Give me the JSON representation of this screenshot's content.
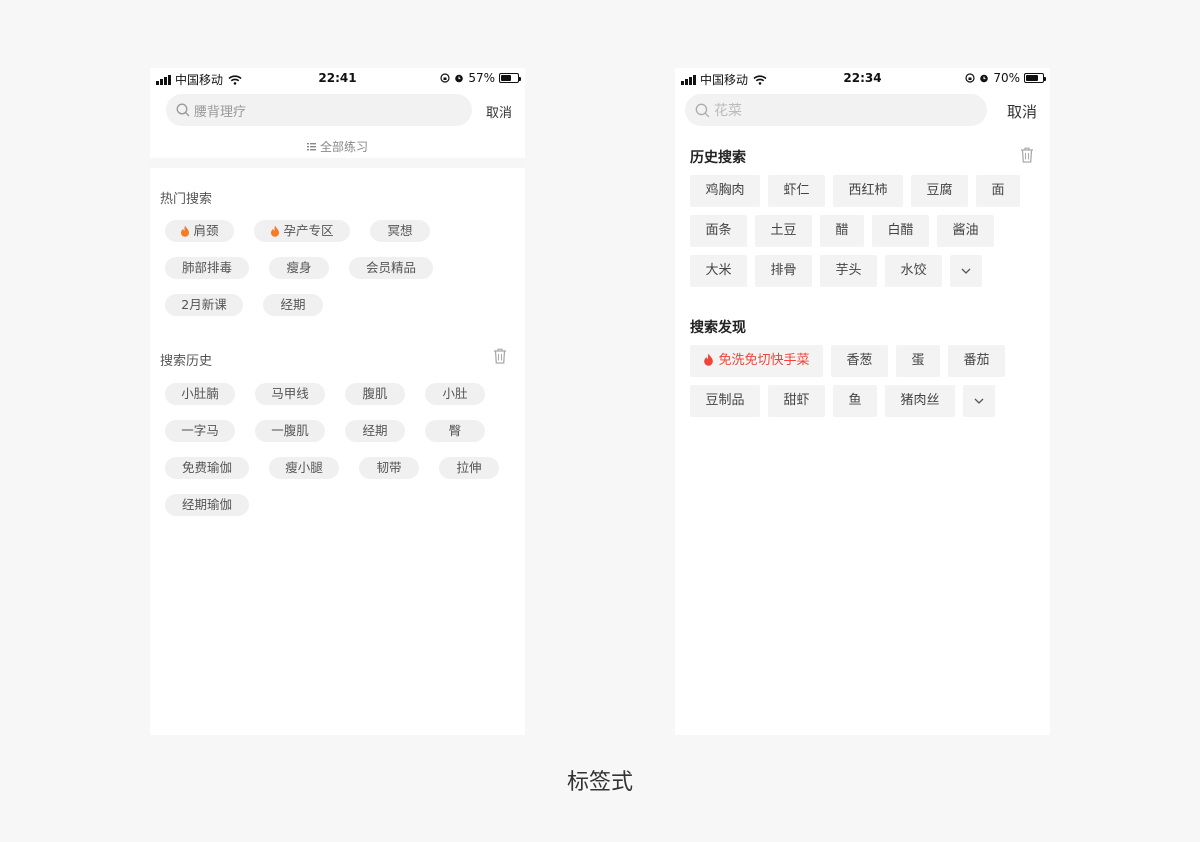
{
  "caption": "标签式",
  "left": {
    "status": {
      "carrier": "中国移动",
      "time": "22:41",
      "battery": "57%",
      "battery_level": 0.57
    },
    "search": {
      "placeholder": "腰背理疗",
      "cancel": "取消"
    },
    "all_practice": "全部练习",
    "hot": {
      "title": "热门搜索",
      "tags": [
        {
          "label": "肩颈",
          "fire": true
        },
        {
          "label": "孕产专区",
          "fire": true
        },
        {
          "label": "冥想",
          "fire": false
        },
        {
          "label": "肺部排毒",
          "fire": false
        },
        {
          "label": "瘦身",
          "fire": false
        },
        {
          "label": "会员精品",
          "fire": false
        },
        {
          "label": "2月新课",
          "fire": false
        },
        {
          "label": "经期",
          "fire": false
        }
      ]
    },
    "history": {
      "title": "搜索历史",
      "tags": [
        "小肚腩",
        "马甲线",
        "腹肌",
        "小肚",
        "一字马",
        "一腹肌",
        "经期",
        "臀",
        "免费瑜伽",
        "瘦小腿",
        "韧带",
        "拉伸",
        "经期瑜伽"
      ]
    }
  },
  "right": {
    "status": {
      "carrier": "中国移动",
      "time": "22:34",
      "battery": "70%",
      "battery_level": 0.7
    },
    "search": {
      "placeholder": "花菜",
      "cancel": "取消"
    },
    "history": {
      "title": "历史搜索",
      "tags": [
        "鸡胸肉",
        "虾仁",
        "西红柿",
        "豆腐",
        "面",
        "面条",
        "土豆",
        "醋",
        "白醋",
        "酱油",
        "大米",
        "排骨",
        "芋头",
        "水饺"
      ]
    },
    "discover": {
      "title": "搜索发现",
      "tags": [
        {
          "label": "免洗免切快手菜",
          "hot": true
        },
        {
          "label": "香葱",
          "hot": false
        },
        {
          "label": "蛋",
          "hot": false
        },
        {
          "label": "番茄",
          "hot": false
        },
        {
          "label": "豆制品",
          "hot": false
        },
        {
          "label": "甜虾",
          "hot": false
        },
        {
          "label": "鱼",
          "hot": false
        },
        {
          "label": "猪肉丝",
          "hot": false
        }
      ]
    }
  },
  "colors": {
    "hot_red": "#f0443a",
    "fire_orange": "#f57b26",
    "tag_bg": "#f0f0f0",
    "page_bg": "#f7f7f7"
  }
}
